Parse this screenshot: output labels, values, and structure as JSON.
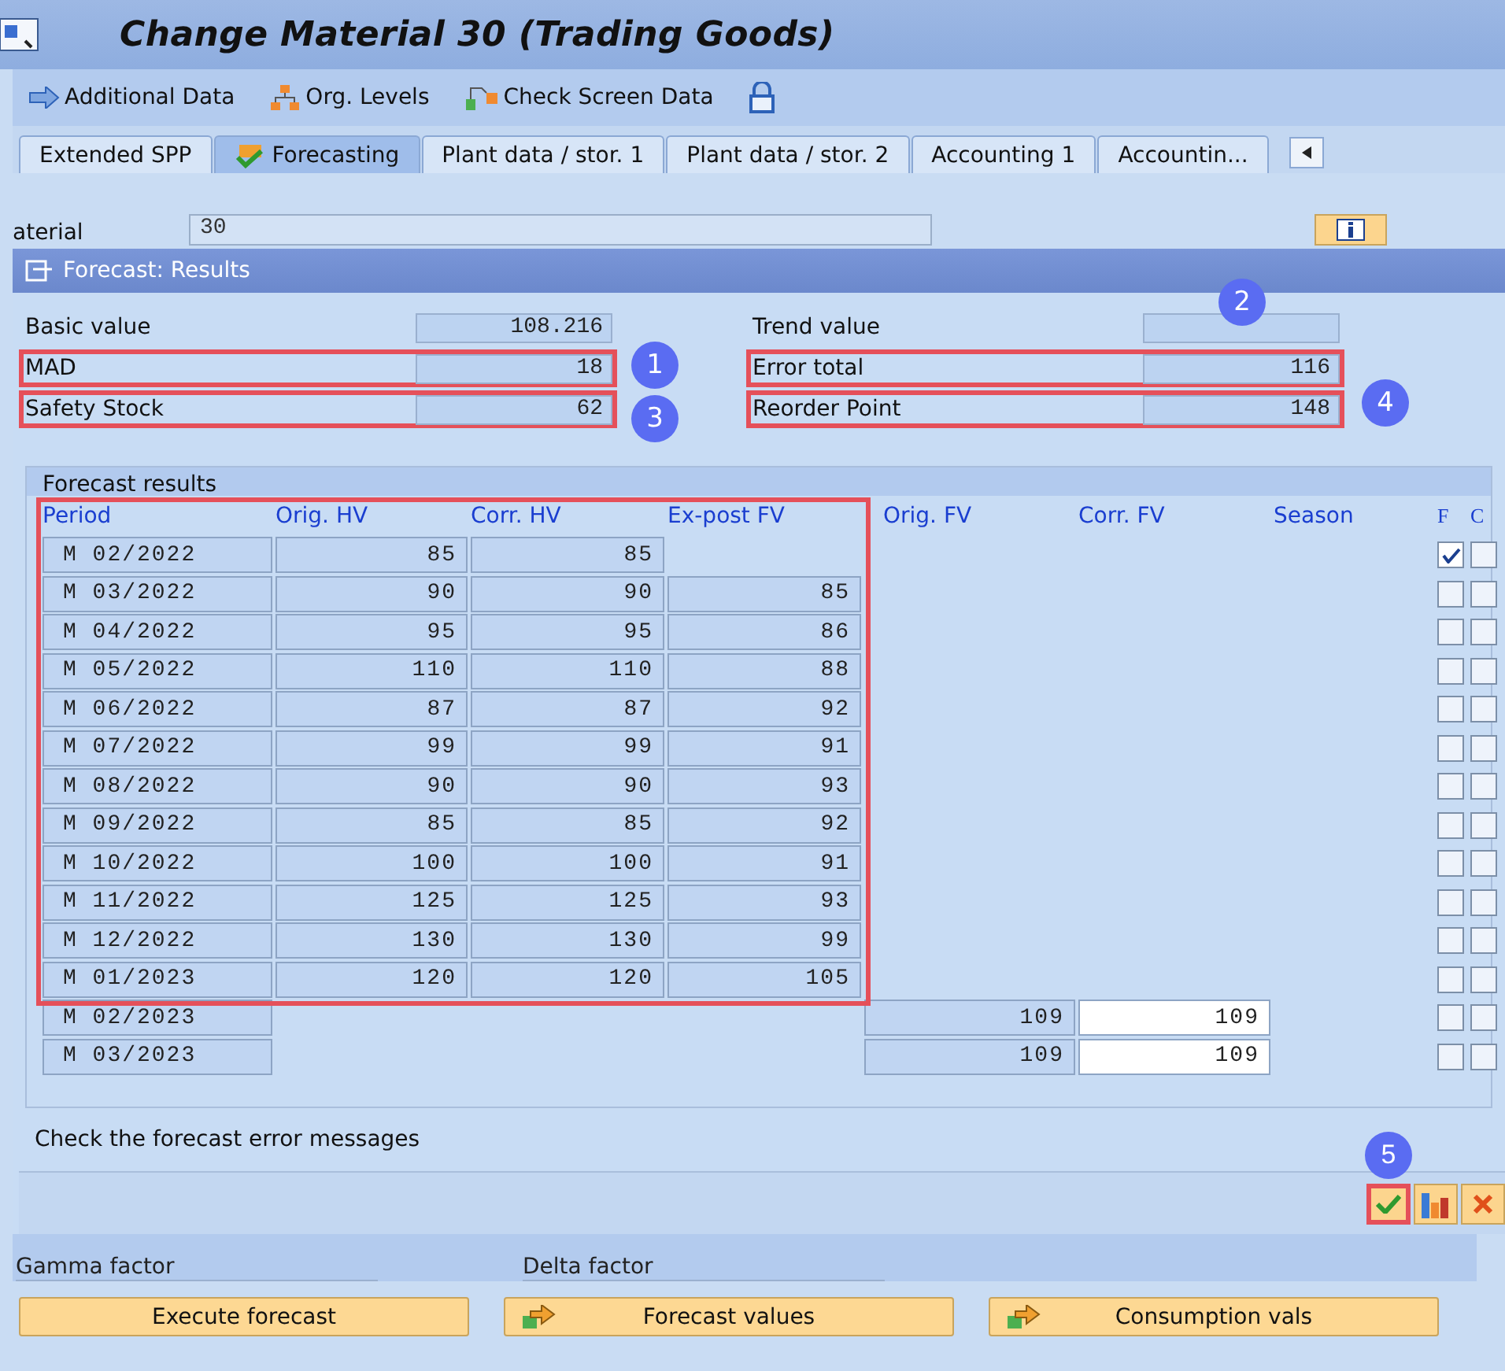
{
  "window": {
    "title": "Change Material 30 (Trading Goods)"
  },
  "toolbar": [
    {
      "label": "Additional Data",
      "kind": "arrow"
    },
    {
      "label": "Org. Levels",
      "kind": "hierarchy"
    },
    {
      "label": "Check Screen Data",
      "kind": "check"
    },
    {
      "kind": "lock"
    }
  ],
  "tabs": [
    {
      "label": "Extended SPP",
      "selected": false
    },
    {
      "label": "Forecasting",
      "selected": true
    },
    {
      "label": "Plant data / stor. 1",
      "selected": false
    },
    {
      "label": "Plant data / stor. 2",
      "selected": false
    },
    {
      "label": "Accounting 1",
      "selected": false
    },
    {
      "label": "Accountin...",
      "selected": false
    }
  ],
  "material": {
    "label": "aterial",
    "value": "30"
  },
  "dialog": {
    "title": "Forecast: Results",
    "fields_left": [
      {
        "label": "Basic value",
        "value": "108.216",
        "highlighted": false
      },
      {
        "label": "MAD",
        "value": "18",
        "highlighted": true,
        "badge": "1"
      },
      {
        "label": "Safety Stock",
        "value": "62",
        "highlighted": true,
        "badge": "3"
      }
    ],
    "fields_right": [
      {
        "label": "Trend value",
        "highlighted": false,
        "badge": "2"
      },
      {
        "label": "Error total",
        "value": "116",
        "highlighted": true
      },
      {
        "label": "Reorder Point",
        "value": "148",
        "highlighted": true,
        "badge": "4"
      }
    ],
    "group_title": "Forecast results",
    "history_highlighted": true,
    "columns": [
      "Period",
      "Orig. HV",
      "Corr. HV",
      "Ex-post FV",
      "Orig. FV",
      "Corr. FV",
      "Season",
      "F",
      "C"
    ],
    "rows": [
      {
        "kind": "history",
        "cells": [
          "M 02/2022",
          "85",
          "85",
          null
        ],
        "f": true,
        "c": false
      },
      {
        "kind": "history",
        "cells": [
          "M 03/2022",
          "90",
          "90",
          "85"
        ],
        "f": false,
        "c": false
      },
      {
        "kind": "history",
        "cells": [
          "M 04/2022",
          "95",
          "95",
          "86"
        ],
        "f": false,
        "c": false
      },
      {
        "kind": "history",
        "cells": [
          "M 05/2022",
          "110",
          "110",
          "88"
        ],
        "f": false,
        "c": false
      },
      {
        "kind": "history",
        "cells": [
          "M 06/2022",
          "87",
          "87",
          "92"
        ],
        "f": false,
        "c": false
      },
      {
        "kind": "history",
        "cells": [
          "M 07/2022",
          "99",
          "99",
          "91"
        ],
        "f": false,
        "c": false
      },
      {
        "kind": "history",
        "cells": [
          "M 08/2022",
          "90",
          "90",
          "93"
        ],
        "f": false,
        "c": false
      },
      {
        "kind": "history",
        "cells": [
          "M 09/2022",
          "85",
          "85",
          "92"
        ],
        "f": false,
        "c": false
      },
      {
        "kind": "history",
        "cells": [
          "M 10/2022",
          "100",
          "100",
          "91"
        ],
        "f": false,
        "c": false
      },
      {
        "kind": "history",
        "cells": [
          "M 11/2022",
          "125",
          "125",
          "93"
        ],
        "f": false,
        "c": false
      },
      {
        "kind": "history",
        "cells": [
          "M 12/2022",
          "130",
          "130",
          "99"
        ],
        "f": false,
        "c": false
      },
      {
        "kind": "history",
        "cells": [
          "M 01/2023",
          "120",
          "120",
          "105"
        ],
        "f": false,
        "c": false
      },
      {
        "kind": "forecast",
        "cells": [
          "M 02/2023",
          null,
          null,
          null,
          "109",
          "109"
        ],
        "f": false,
        "c": false
      },
      {
        "kind": "forecast",
        "cells": [
          "M 03/2023",
          null,
          null,
          null,
          "109",
          "109"
        ],
        "f": false,
        "c": false
      }
    ],
    "message": "Check the forecast error messages",
    "footer_buttons": [
      {
        "kind": "confirm",
        "highlighted": true,
        "badge": "5"
      },
      {
        "kind": "chart",
        "highlighted": false
      },
      {
        "kind": "cancel",
        "highlighted": false
      }
    ]
  },
  "factors": [
    {
      "label": "Gamma factor"
    },
    {
      "label": "Delta factor"
    }
  ],
  "actions": [
    {
      "label": "Execute forecast",
      "icon": false
    },
    {
      "label": "Forecast values",
      "icon": true
    },
    {
      "label": "Consumption vals",
      "icon": true
    }
  ]
}
